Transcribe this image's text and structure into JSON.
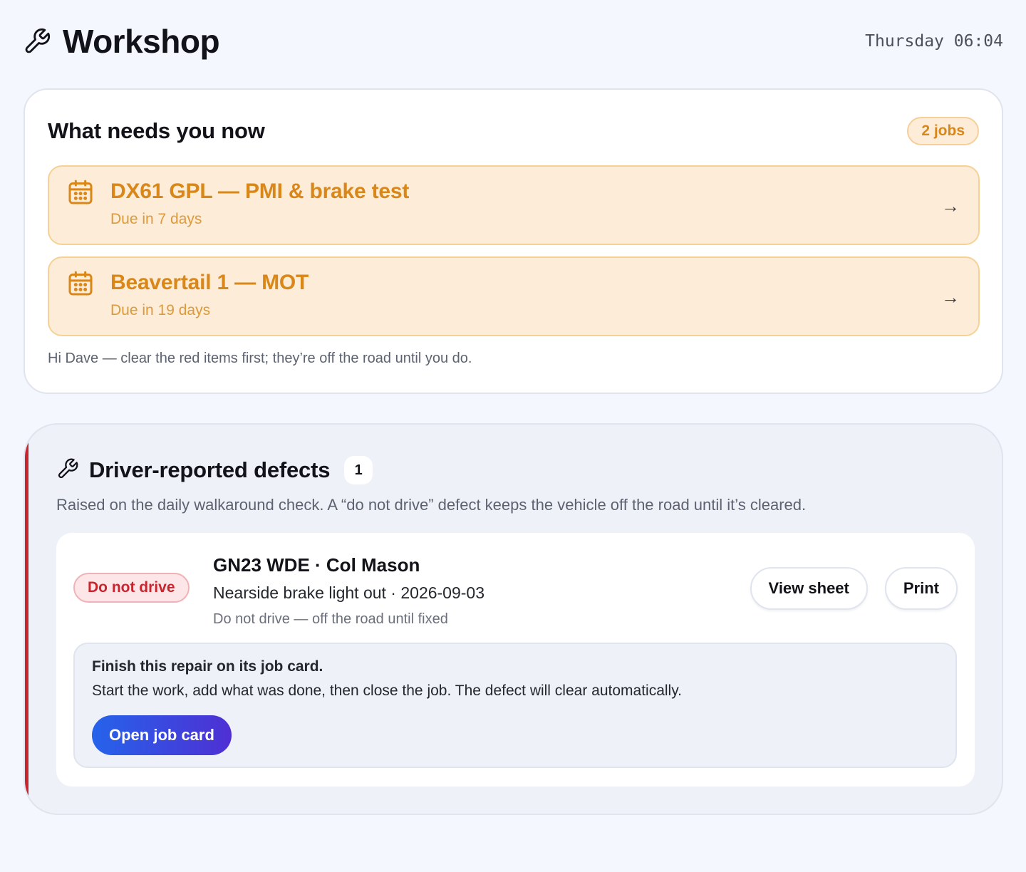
{
  "header": {
    "title": "Workshop",
    "clock": "Thursday 06:04"
  },
  "now_card": {
    "title": "What needs you now",
    "count_badge": "2 jobs",
    "jobs": [
      {
        "title": "DX61 GPL — PMI & brake test",
        "due": "Due in 7 days",
        "arrow": "→",
        "icon": "calendar-icon"
      },
      {
        "title": "Beavertail 1 — MOT",
        "due": "Due in 19 days",
        "arrow": "→",
        "icon": "calendar-icon"
      }
    ],
    "hint": "Hi Dave — clear the red items first; they’re off the road until you do."
  },
  "defects": {
    "title": "Driver-reported defects",
    "count": "1",
    "subtitle": "Raised on the daily walkaround check. A “do not drive” defect keeps the vehicle off the road until it’s cleared.",
    "items": [
      {
        "status_badge": "Do not drive",
        "vehicle": "GN23 WDE · Col Mason",
        "description": "Nearside brake light out · 2026-09-03",
        "note": "Do not drive — off the road until fixed",
        "view_button": "View sheet",
        "print_button": "Print",
        "repair": {
          "title": "Finish this repair on its job card.",
          "text": "Start the work, add what was done, then close the job. The defect will clear automatically.",
          "button": "Open job card"
        }
      }
    ]
  },
  "colors": {
    "accent_amber": "#d98719",
    "danger_red": "#c7262f",
    "primary_gradient_start": "#2563eb",
    "primary_gradient_end": "#4f2fd4"
  }
}
